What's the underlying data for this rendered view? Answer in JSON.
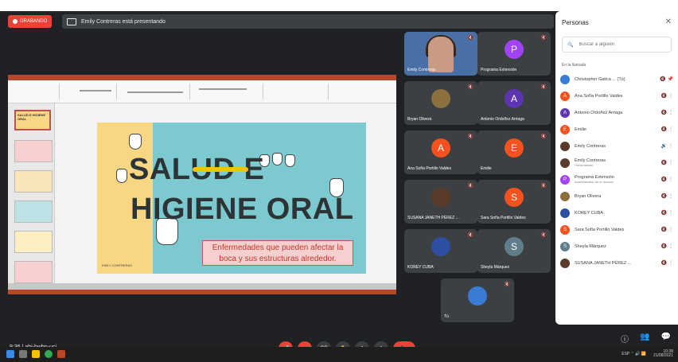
{
  "meet": {
    "recording_label": "GRABANDO",
    "presenting_text": "Emily Contreras está presentando",
    "meeting_code": "9:36 | ahj-hwbn-uci"
  },
  "slide": {
    "title_line1": "SALUD E",
    "title_line2": "HIGIENE ORAL",
    "subtitle": "Enfermedades que pueden afectar la boca y sus estructuras alrededor.",
    "author": "EMILY CONTRERAS"
  },
  "thumb_label": "SALUD E HIGIENE ORAL",
  "tiles": [
    {
      "name": "Emily Contreras",
      "type": "video"
    },
    {
      "name": "Programa Extensión",
      "type": "avatar",
      "letter": "P",
      "color": "#a142f4"
    },
    {
      "name": "Bryan Olivera",
      "type": "photo",
      "color": "#8d6e3f"
    },
    {
      "name": "Antonio Ordoñez Arriaga",
      "type": "avatar",
      "letter": "A",
      "color": "#5e35b1"
    },
    {
      "name": "Ana Sofía Portillo Valdes",
      "type": "avatar",
      "letter": "A",
      "color": "#f4511e"
    },
    {
      "name": "Emilie",
      "type": "avatar",
      "letter": "E",
      "color": "#f4511e"
    },
    {
      "name": "SUSANA JANETH PÉREZ ...",
      "type": "photo",
      "color": "#5a3a2a"
    },
    {
      "name": "Sara Sofía Portillo Valdes",
      "type": "avatar",
      "letter": "S",
      "color": "#f4511e"
    },
    {
      "name": "KOREY CUBA",
      "type": "photo",
      "color": "#2d4fa1"
    },
    {
      "name": "Sheyla Márquez",
      "type": "avatar",
      "letter": "S",
      "color": "#607d8b"
    },
    {
      "name": "Tú",
      "type": "photo",
      "color": "#3a7bd5"
    }
  ],
  "panel": {
    "title": "Personas",
    "close": "✕",
    "search_placeholder": "Buscar a alguien",
    "section": "En la llamada",
    "people": [
      {
        "name": "Christopher Gatica ... (Tú)",
        "sub": "",
        "letter": "",
        "color": "#3a7bd5",
        "icons": "🔇 📌"
      },
      {
        "name": "Ana Sofía Portillo Valdes",
        "sub": "",
        "letter": "A",
        "color": "#f4511e",
        "icons": "🔇 ⋮"
      },
      {
        "name": "Antonio Ordoñez Arriaga",
        "sub": "",
        "letter": "A",
        "color": "#5e35b1",
        "icons": "🔇 ⋮"
      },
      {
        "name": "Emilie",
        "sub": "",
        "letter": "E",
        "color": "#f4511e",
        "icons": "🔇 ⋮"
      },
      {
        "name": "Emily Contreras",
        "sub": "",
        "letter": "",
        "color": "#5a3a2a",
        "icons": "🔊 ⋮"
      },
      {
        "name": "Emily Contreras",
        "sub": "Presentación",
        "letter": "",
        "color": "#5a3a2a",
        "icons": "🔇 ⋮"
      },
      {
        "name": "Programa Extensión",
        "sub": "Administrador de la reunión",
        "letter": "P",
        "color": "#a142f4",
        "icons": "🔇 ⋮"
      },
      {
        "name": "Bryan Olivera",
        "sub": "",
        "letter": "",
        "color": "#8d6e3f",
        "icons": "🔇 ⋮"
      },
      {
        "name": "KOREY CUBA",
        "sub": "",
        "letter": "",
        "color": "#2d4fa1",
        "icons": "🔇 ⋮"
      },
      {
        "name": "Sara Sofía Portillo Valdes",
        "sub": "",
        "letter": "S",
        "color": "#f4511e",
        "icons": "🔇 ⋮"
      },
      {
        "name": "Sheyla Márquez",
        "sub": "",
        "letter": "S",
        "color": "#607d8b",
        "icons": "🔇 ⋮"
      },
      {
        "name": "SUSANA JANETH PÉREZ ...",
        "sub": "",
        "letter": "",
        "color": "#5a3a2a",
        "icons": "🔇 ⋮"
      }
    ]
  },
  "controls": {
    "mic": "🎤",
    "cam": "📷",
    "cc": "CC",
    "hand": "✋",
    "present": "⬆",
    "more": "⋮",
    "end": "📞"
  },
  "right_icons": {
    "info": "ⓘ",
    "people": "👥",
    "chat": "💬",
    "activities": "⚙"
  },
  "taskbar": {
    "clock_time": "10:38",
    "clock_date": "21/08/2021",
    "tray": "ESP  ⌃  🔊  📶"
  }
}
